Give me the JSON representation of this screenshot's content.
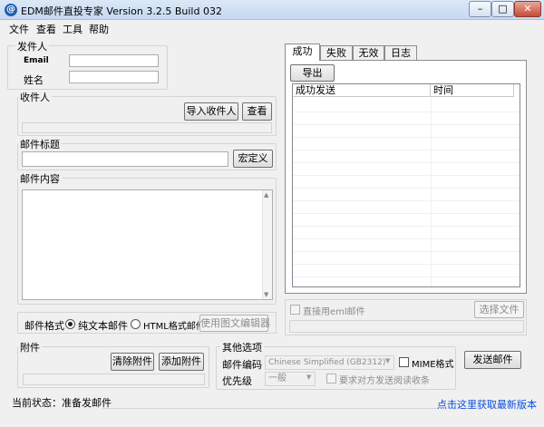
{
  "window": {
    "title": "EDM邮件直投专家 Version 3.2.5 Build 032",
    "icon_glyph": "@",
    "min_glyph": "–",
    "max_glyph": "□",
    "close_glyph": "✕"
  },
  "menu": [
    "文件",
    "查看",
    "工具",
    "帮助"
  ],
  "sender": {
    "legend": "发件人",
    "email_label": "Email",
    "email_value": "",
    "name_label": "姓名",
    "name_value": ""
  },
  "recipient": {
    "legend": "收件人",
    "import_button": "导入收件人",
    "view_button": "查看"
  },
  "subject": {
    "legend": "邮件标题",
    "value": "",
    "custom_button": "宏定义"
  },
  "content": {
    "legend": "邮件内容",
    "value": ""
  },
  "format": {
    "label": "邮件格式",
    "plain_label": "纯文本邮件",
    "html_label": "HTML格式邮件",
    "selected": "plain",
    "editor_button": "使用图文编辑器"
  },
  "tabs": [
    {
      "label": "成功",
      "active": true
    },
    {
      "label": "失败",
      "active": false
    },
    {
      "label": "无效",
      "active": false
    },
    {
      "label": "日志",
      "active": false
    }
  ],
  "results": {
    "export_button": "导出",
    "columns": [
      "成功发送",
      "时间"
    ],
    "rows": []
  },
  "eml": {
    "checkbox_label": "直接用eml邮件",
    "checked": false,
    "select_button": "选择文件"
  },
  "attachments": {
    "legend": "附件",
    "clear_button": "清除附件",
    "add_button": "添加附件"
  },
  "options": {
    "legend": "其他选项",
    "encoding_label": "邮件编码",
    "encoding_value": "Chinese Simplified (GB2312)",
    "mime_label": "MIME格式",
    "mime_checked": false,
    "priority_label": "优先级",
    "priority_value": "一般",
    "receipt_label": "要求对方发送阅读收条",
    "receipt_checked": false
  },
  "send_button": "发送邮件",
  "status": {
    "text": "当前状态：准备发邮件",
    "link": "点击这里获取最新版本",
    "link_color": "#0b4fd9"
  }
}
